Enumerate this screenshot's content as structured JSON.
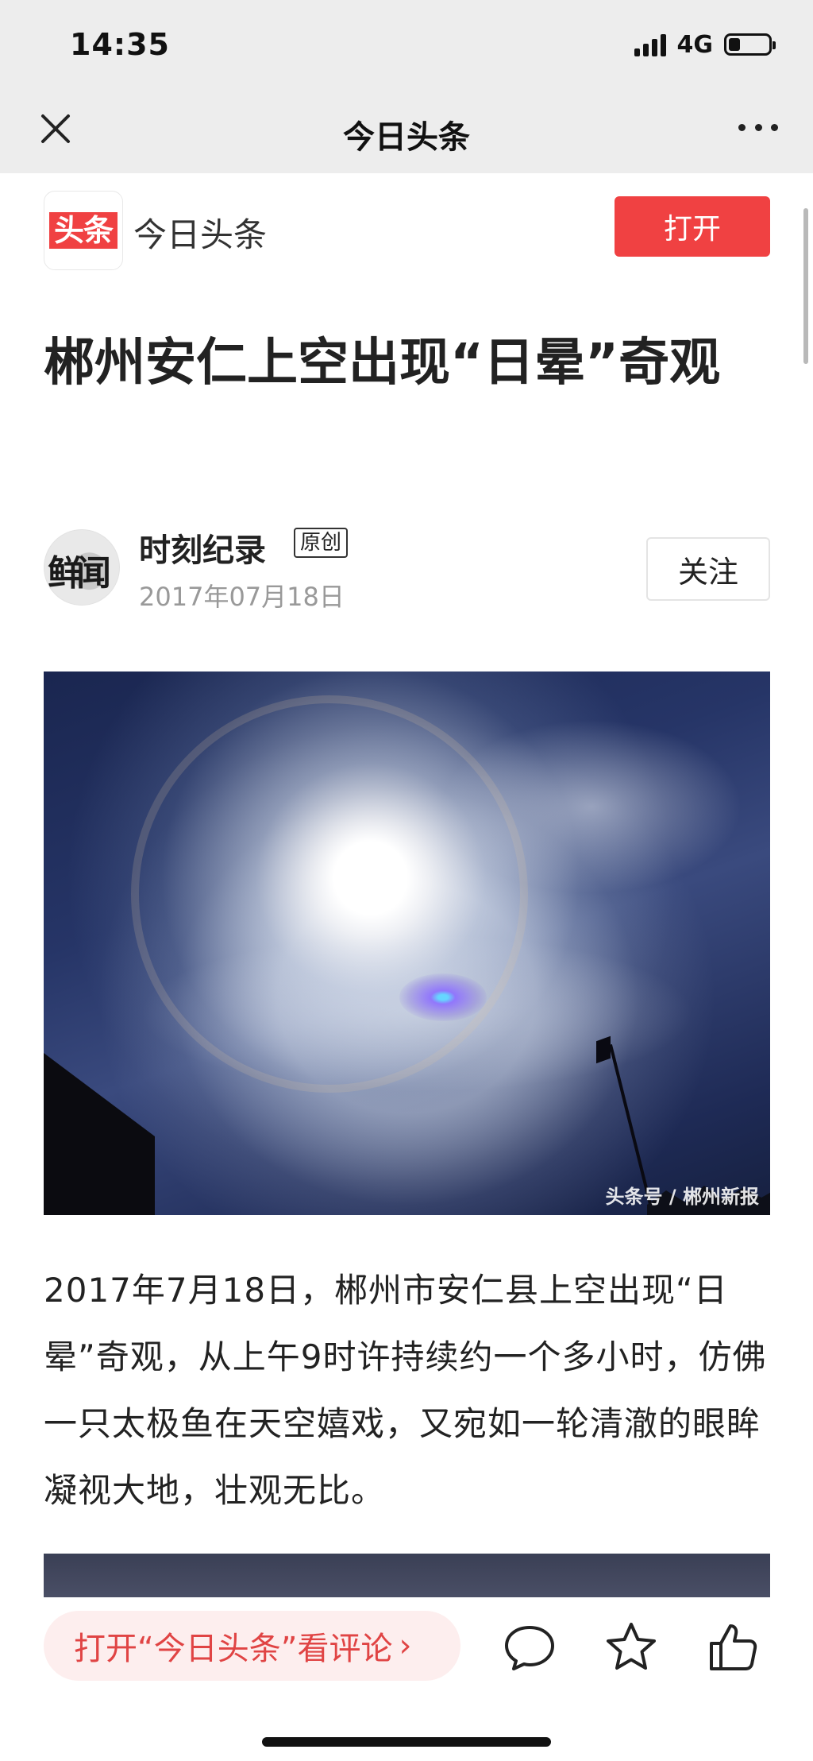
{
  "status_bar": {
    "time": "14:35",
    "network": "4G",
    "battery_level": 0.3
  },
  "nav": {
    "title": "今日头条",
    "close_icon": "close-icon",
    "more_icon": "more-icon"
  },
  "app_bar": {
    "logo_text": "头条",
    "app_name": "今日头条",
    "open_label": "打开",
    "accent_color": "#f04142"
  },
  "article": {
    "title": "郴州安仁上空出现“日晕”奇观",
    "author": {
      "name": "时刻纪录",
      "badge": "原创",
      "date": "2017年07月18日",
      "avatar_text": "鲜闻",
      "follow_label": "关注"
    },
    "image": {
      "watermark": "头条号 / 郴州新报"
    },
    "paragraph": "2017年7月18日，郴州市安仁县上空出现“日晕”奇观，从上午9时许持续约一个多小时，仿佛一只太极鱼在天空嬉戏，又宛如一轮清澈的眼眸凝视大地，壮观无比。"
  },
  "bottom_bar": {
    "comment_cta": "打开“今日头条”看评论",
    "chevron": "›",
    "icons": [
      "comment-icon",
      "star-icon",
      "thumbs-up-icon"
    ]
  }
}
